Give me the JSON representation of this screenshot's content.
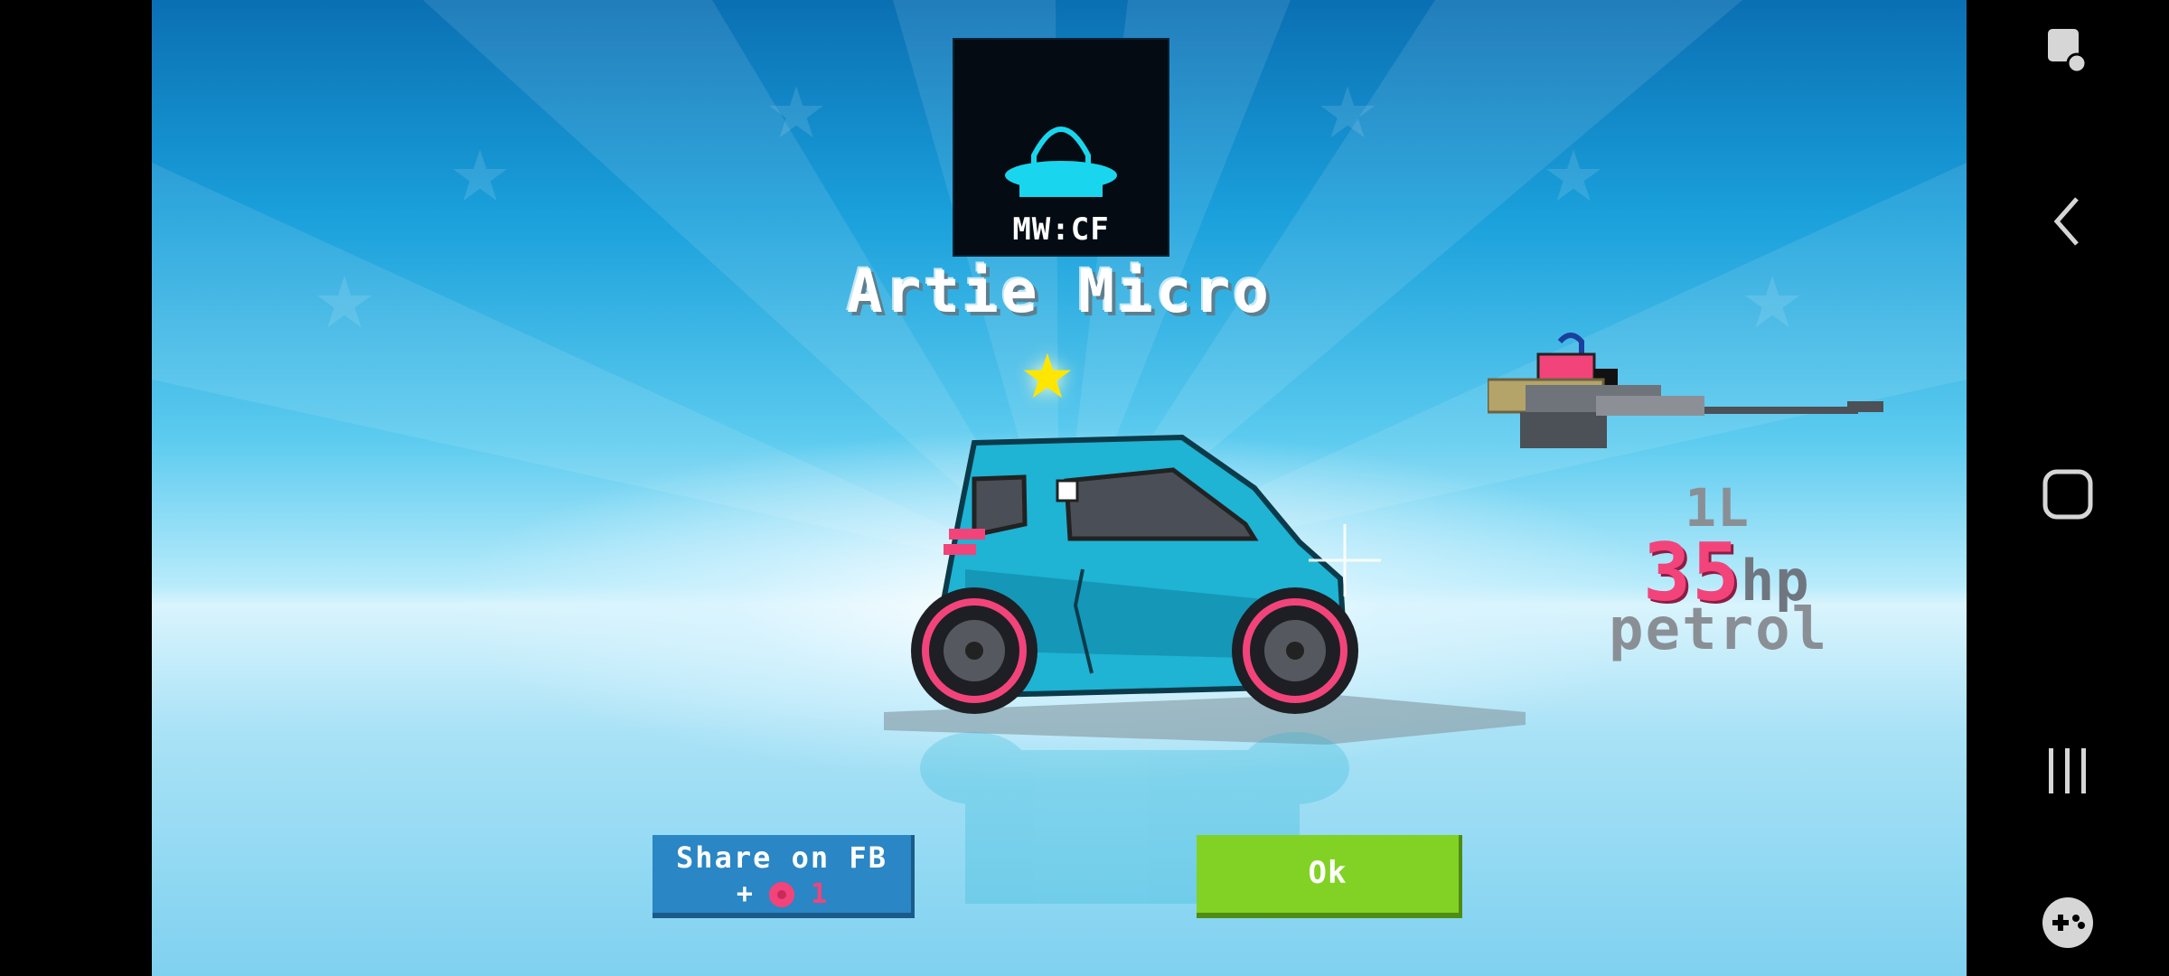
{
  "badge": {
    "label": "MW:CF",
    "icon": "ufo-icon"
  },
  "car": {
    "name": "Artie Micro",
    "rank_icon": "star-icon"
  },
  "specs": {
    "engine_size": "1L",
    "horsepower": "35",
    "hp_unit": "hp",
    "fuel": "petrol"
  },
  "buttons": {
    "share_label": "Share on FB",
    "share_reward_prefix": "+",
    "share_reward_amount": "1",
    "ok_label": "Ok"
  },
  "navbar": {
    "icons": [
      "screen-touch-icon",
      "back-icon",
      "home-icon",
      "recents-icon",
      "game-controller-icon"
    ]
  },
  "colors": {
    "accent_pink": "#f2447a",
    "ok_green": "#82d225",
    "share_blue": "#2a86c4",
    "car_teal": "#1fb3d4",
    "star_yellow": "#ffe600"
  }
}
